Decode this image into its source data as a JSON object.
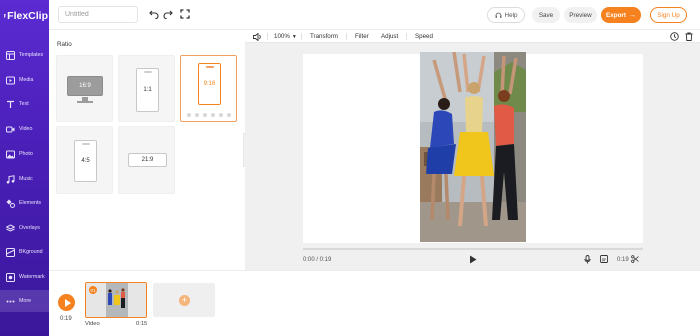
{
  "app": {
    "name": "FlexClip"
  },
  "header": {
    "title_placeholder": "Untitled",
    "help_label": "Help",
    "save_label": "Save",
    "preview_label": "Preview",
    "export_label": "Export",
    "signup_label": "Sign Up"
  },
  "sidebar": {
    "items": [
      {
        "label": "Templates",
        "icon": "templates-icon"
      },
      {
        "label": "Media",
        "icon": "media-icon"
      },
      {
        "label": "Text",
        "icon": "text-icon"
      },
      {
        "label": "Video",
        "icon": "video-icon"
      },
      {
        "label": "Photo",
        "icon": "photo-icon"
      },
      {
        "label": "Music",
        "icon": "music-icon"
      },
      {
        "label": "Elements",
        "icon": "elements-icon"
      },
      {
        "label": "Overlays",
        "icon": "overlays-icon"
      },
      {
        "label": "BKground",
        "icon": "background-icon"
      },
      {
        "label": "Watermark",
        "icon": "watermark-icon"
      },
      {
        "label": "More",
        "icon": "more-icon"
      }
    ],
    "active": "More"
  },
  "ratio_panel": {
    "title": "Ratio",
    "ratios": [
      "16:9",
      "1:1",
      "9:16",
      "4:5",
      "21:9"
    ],
    "selected": "9:16"
  },
  "editor_toolbar": {
    "zoom": "100%",
    "transform_label": "Transform",
    "filter_label": "Filter",
    "adjust_label": "Adjust",
    "speed_label": "Speed"
  },
  "player": {
    "current_time": "0:00 / 0:19",
    "duration": "0:19"
  },
  "timeline": {
    "total_time": "0:19",
    "clip_number": "01",
    "clip_label": "Video",
    "clip_duration": "0:15"
  },
  "colors": {
    "accent": "#f5821f",
    "sidebar": "#4a1fb8"
  }
}
